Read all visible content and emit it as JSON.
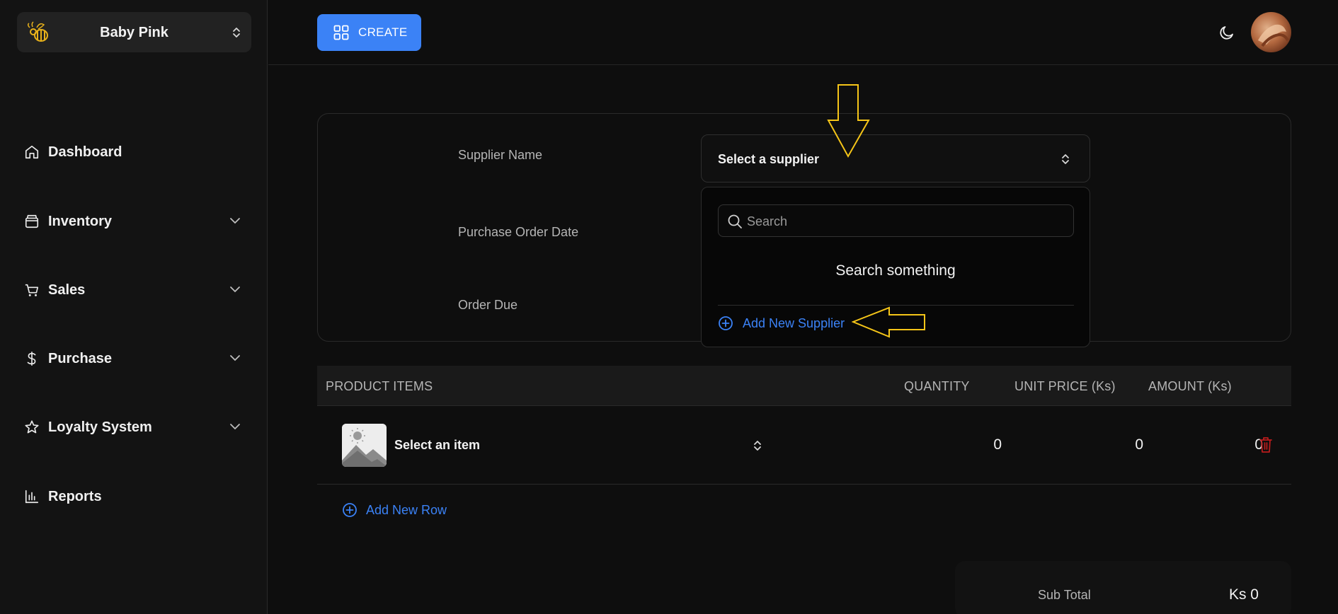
{
  "sidebar": {
    "store_name": "Baby Pink",
    "items": [
      {
        "label": "Dashboard",
        "icon": "home-icon"
      },
      {
        "label": "Inventory",
        "icon": "box-icon"
      },
      {
        "label": "Sales",
        "icon": "cart-icon"
      },
      {
        "label": "Purchase",
        "icon": "dollar-icon"
      },
      {
        "label": "Loyalty System",
        "icon": "star-icon"
      },
      {
        "label": "Reports",
        "icon": "bar-chart-icon"
      }
    ]
  },
  "header": {
    "create_label": "CREATE"
  },
  "form": {
    "supplier_label": "Supplier Name",
    "po_date_label": "Purchase Order Date",
    "order_due_label": "Order Due",
    "supplier_value": "Select a supplier"
  },
  "dropdown": {
    "search_placeholder": "Search",
    "empty_text": "Search something",
    "add_label": "Add New Supplier"
  },
  "table": {
    "headers": {
      "product": "PRODUCT ITEMS",
      "quantity": "QUANTITY",
      "unit_price": "UNIT PRICE (Ks)",
      "amount": "AMOUNT (Ks)"
    },
    "rows": [
      {
        "item": "Select an item",
        "quantity": "0",
        "unit_price": "0",
        "amount": "0"
      }
    ],
    "add_row_label": "Add New Row"
  },
  "totals": {
    "subtotal_label": "Sub Total",
    "subtotal_value": "Ks 0"
  },
  "colors": {
    "accent": "#3b82f6",
    "annotation": "#f5c518",
    "danger": "#b91c1c"
  }
}
